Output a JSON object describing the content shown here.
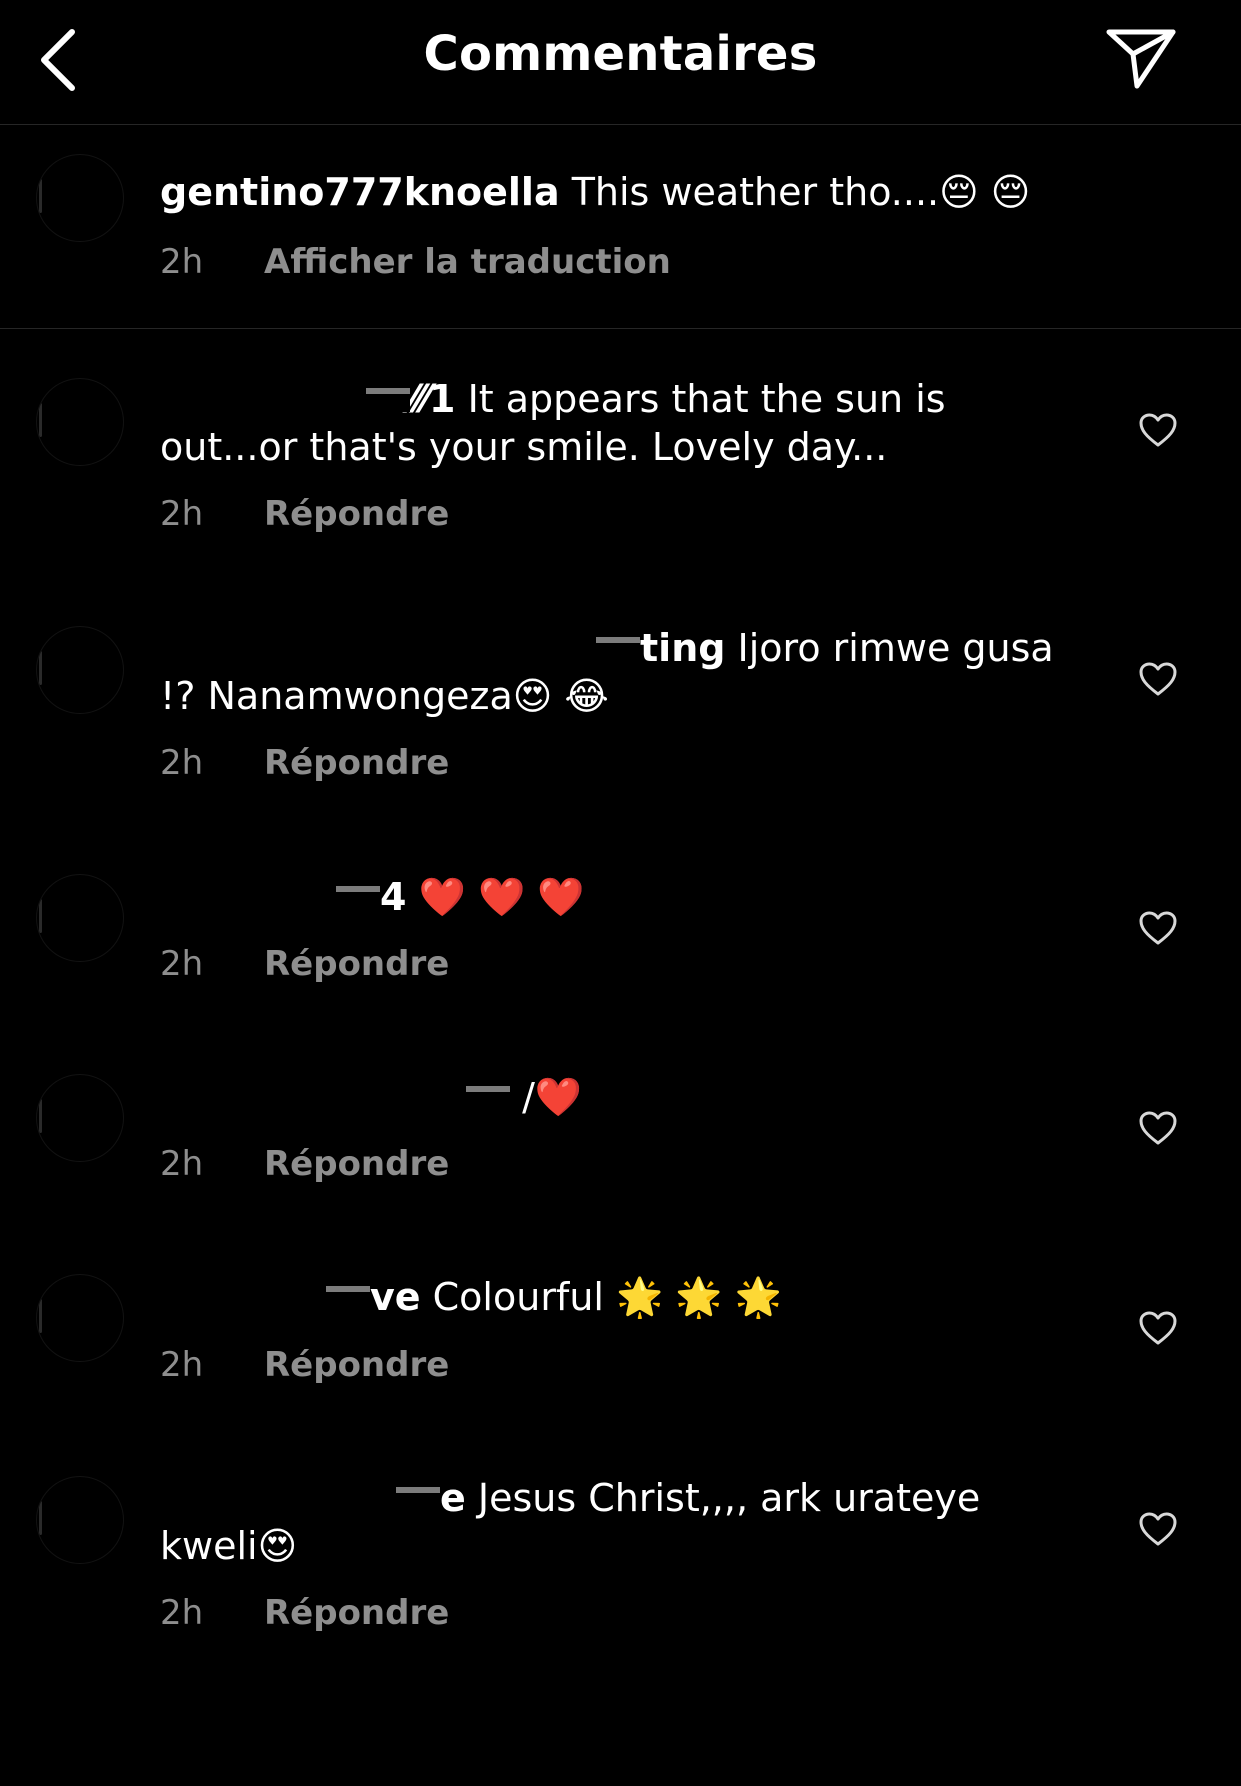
{
  "header": {
    "title": "Commentaires",
    "back_icon": "chevron-left-icon",
    "share_icon": "paper-plane-icon"
  },
  "caption": {
    "username": "gentino777knoella",
    "text": "This weather tho....😔 😔",
    "time": "2h",
    "action": "Afficher la traduction"
  },
  "comments": [
    {
      "username_visible": "⁄⁄⁄1",
      "text": "It appears that the sun is out...or that's your smile. Lovely day...",
      "time": "2h",
      "action": "Répondre"
    },
    {
      "username_visible": "ting",
      "text": "Ijoro rimwe gusa !? Nanamwongeza😍 😂",
      "time": "2h",
      "action": "Répondre"
    },
    {
      "username_visible": "4",
      "text": "❤️ ❤️ ❤️",
      "time": "2h",
      "action": "Répondre"
    },
    {
      "username_visible": "",
      "text": "/❤️",
      "time": "2h",
      "action": "Répondre"
    },
    {
      "username_visible": "ve",
      "text": "Colourful 🌟 🌟 🌟",
      "time": "2h",
      "action": "Répondre"
    },
    {
      "username_visible": "e",
      "text": "Jesus Christ,,,, ark urateye kweli😍",
      "time": "2h",
      "action": "Répondre"
    }
  ],
  "colors": {
    "background": "#000000",
    "text": "#ffffff",
    "secondary": "#8e8e8e",
    "divider": "#262626"
  }
}
